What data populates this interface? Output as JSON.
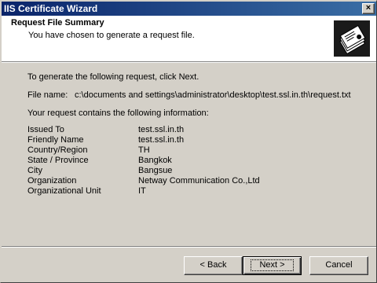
{
  "window": {
    "title": "IIS Certificate Wizard",
    "close_glyph": "×"
  },
  "header": {
    "title": "Request File Summary",
    "subtitle": "You have chosen to generate a request file.",
    "icon": "certificate-wizard-icon"
  },
  "body": {
    "intro": "To generate the following request, click Next.",
    "file_label": "File name:",
    "file_value": "c:\\documents and settings\\administrator\\desktop\\test.ssl.in.th\\request.txt",
    "info_line": "Your request contains the following information:",
    "details": [
      {
        "label": "Issued To",
        "value": "test.ssl.in.th"
      },
      {
        "label": "Friendly Name",
        "value": "test.ssl.in.th"
      },
      {
        "label": "Country/Region",
        "value": "TH"
      },
      {
        "label": "State / Province",
        "value": "Bangkok"
      },
      {
        "label": "City",
        "value": "Bangsue"
      },
      {
        "label": "Organization",
        "value": "Netway Communication Co.,Ltd"
      },
      {
        "label": "Organizational Unit",
        "value": "IT"
      }
    ]
  },
  "buttons": {
    "back": "< Back",
    "next": "Next >",
    "cancel": "Cancel"
  }
}
